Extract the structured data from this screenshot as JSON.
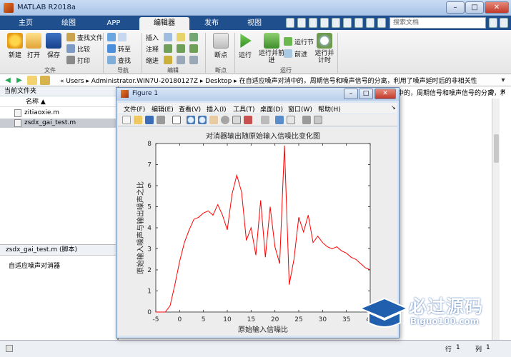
{
  "window": {
    "title": "MATLAB R2018a",
    "minimize": "–",
    "maximize": "□",
    "close": "✕"
  },
  "tabs": [
    {
      "label": "主页"
    },
    {
      "label": "绘图"
    },
    {
      "label": "APP"
    },
    {
      "label": "编辑器"
    },
    {
      "label": "发布"
    },
    {
      "label": "视图"
    }
  ],
  "search": {
    "placeholder": "搜索文档"
  },
  "ribbon": {
    "file": {
      "new": "新建",
      "open": "打开",
      "save": "保存",
      "find_files": "查找文件",
      "compare": "比较",
      "print": "打印",
      "group": "文件"
    },
    "navigate": {
      "goto": "转至",
      "find": "查找",
      "group": "导航"
    },
    "edit": {
      "insert": "插入",
      "comment": "注释",
      "indent": "缩进",
      "group": "编辑"
    },
    "breakpoints": {
      "label": "断点",
      "group": "断点"
    },
    "run": {
      "run": "运行",
      "run_advance": "运行并前进",
      "run_section": "运行节",
      "advance": "前进",
      "run_time": "运行并计时",
      "group": "运行"
    }
  },
  "address": {
    "path": "« Users ▸ Administrator.WIN7U-20180127Z ▸ Desktop ▸ 在自适应噪声对消中的，周期信号和噪声信号的分离，利用了噪声延时后的非相关性"
  },
  "left_pane": {
    "header": "当前文件夹",
    "column": "名称 ▲",
    "files": [
      "zitiaoxie.m",
      "zsdx_gai_test.m"
    ],
    "details_header": "zsdx_gai_test.m  (脚本)",
    "details_text": "自适应噪声对消器"
  },
  "editor_tab": "中的，周期信号和噪声信号的分离，利用了...",
  "figure": {
    "title": "Figure 1",
    "menu": [
      "文件(F)",
      "编辑(E)",
      "查看(V)",
      "插入(I)",
      "工具(T)",
      "桌面(D)",
      "窗口(W)",
      "帮助(H)"
    ]
  },
  "status": {
    "row_label": "行",
    "row": "1",
    "col_label": "列",
    "col": "1"
  },
  "watermark": {
    "title": "必过源码",
    "url": "Biguo100.com"
  },
  "chart_data": {
    "type": "line",
    "title": "对消器输出随原始输入信噪比变化图",
    "xlabel": "原始输入信噪比",
    "ylabel": "原始输入噪声与输出噪声之比",
    "xlim": [
      -5,
      40
    ],
    "ylim": [
      0,
      8
    ],
    "xticks": [
      -5,
      0,
      5,
      10,
      15,
      20,
      25,
      30,
      35,
      40
    ],
    "yticks": [
      0,
      1,
      2,
      3,
      4,
      5,
      6,
      7,
      8
    ],
    "grid": false,
    "series": [
      {
        "color": "#ff0000",
        "x": [
          -5,
          -4,
          -3,
          -2,
          -1,
          0,
          1,
          2,
          3,
          4,
          5,
          6,
          7,
          8,
          9,
          10,
          11,
          12,
          13,
          14,
          15,
          16,
          17,
          18,
          19,
          20,
          21,
          22,
          23,
          24,
          25,
          26,
          27,
          28,
          29,
          30,
          31,
          32,
          33,
          34,
          35,
          36,
          37,
          38,
          39,
          40
        ],
        "y": [
          0.0,
          0.0,
          0.0,
          0.3,
          1.3,
          2.4,
          3.3,
          3.9,
          4.4,
          4.5,
          4.7,
          4.8,
          4.6,
          5.1,
          4.6,
          3.9,
          5.6,
          6.5,
          5.7,
          3.4,
          4.0,
          2.7,
          5.3,
          2.6,
          5.0,
          3.1,
          2.3,
          7.9,
          1.3,
          2.5,
          4.5,
          3.8,
          4.6,
          3.3,
          3.6,
          3.3,
          3.1,
          3.0,
          3.1,
          2.9,
          2.8,
          2.6,
          2.5,
          2.3,
          2.1,
          2.0
        ]
      }
    ]
  }
}
